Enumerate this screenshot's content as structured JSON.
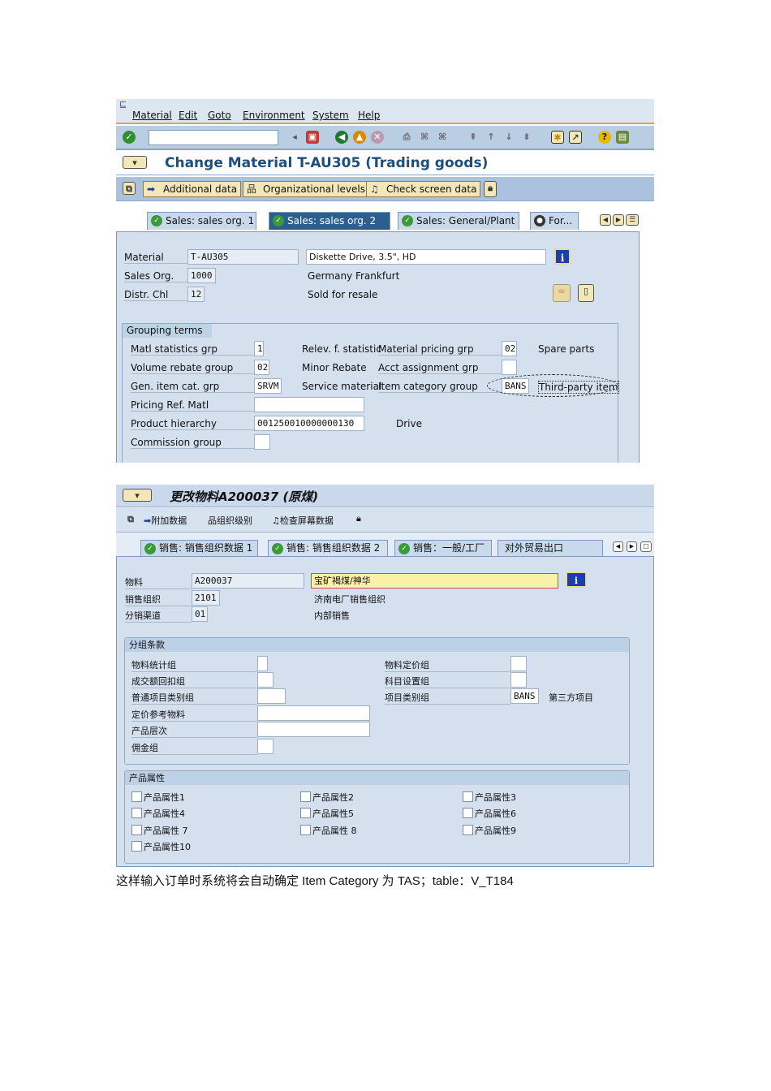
{
  "s1": {
    "menu": [
      "Material",
      "Edit",
      "Goto",
      "Environment",
      "System",
      "Help"
    ],
    "title": "Change Material T-AU305 (Trading goods)",
    "buttons": {
      "additional": "Additional data",
      "org": "Organizational levels",
      "check": "Check screen data"
    },
    "tabs": [
      "Sales: sales org. 1",
      "Sales: sales org. 2",
      "Sales: General/Plant",
      "For..."
    ],
    "header": {
      "material_label": "Material",
      "material": "T-AU305",
      "material_desc": "Diskette Drive, 3.5\", HD",
      "salesorg_label": "Sales Org.",
      "salesorg": "1000",
      "salesorg_desc": "Germany Frankfurt",
      "distr_label": "Distr. Chl",
      "distr": "12",
      "distr_desc": "Sold for resale"
    },
    "group": {
      "title": "Grouping terms",
      "matl_stat_label": "Matl statistics grp",
      "matl_stat": "1",
      "matl_stat_desc": "Relev. f. statistic",
      "vol_rebate_label": "Volume rebate group",
      "vol_rebate": "02",
      "vol_rebate_desc": "Minor Rebate",
      "gen_item_label": "Gen. item cat. grp",
      "gen_item": "SRVM",
      "gen_item_desc": "Service material",
      "pricing_ref_label": "Pricing Ref. Matl",
      "pricing_ref": "",
      "prod_hier_label": "Product hierarchy",
      "prod_hier": "001250010000000130",
      "prod_hier_desc": "Drive",
      "commission_label": "Commission group",
      "commission": "",
      "mat_pricing_label": "Material pricing grp",
      "mat_pricing": "02",
      "mat_pricing_desc": "Spare parts",
      "acct_label": "Acct assignment grp",
      "acct": "",
      "item_cat_label": "Item category group",
      "item_cat": "BANS",
      "item_cat_desc": "Third-party item"
    }
  },
  "s2": {
    "title": "更改物料A200037 (原煤)",
    "buttons": {
      "additional": "附加数据",
      "org": "组织级别",
      "check": "检查屏幕数据"
    },
    "tabs": [
      "销售: 销售组织数据 1",
      "销售: 销售组织数据 2",
      "销售：一般/工厂",
      "对外贸易出口"
    ],
    "header": {
      "material_label": "物料",
      "material": "A200037",
      "material_desc": "宝矿褐煤/神华",
      "salesorg_label": "销售组织",
      "salesorg": "2101",
      "salesorg_desc": "济南电厂销售组织",
      "distr_label": "分销渠道",
      "distr": "01",
      "distr_desc": "内部销售"
    },
    "group": {
      "title": "分组条款",
      "l": [
        "物料统计组",
        "成交额回扣组",
        "普通项目类别组",
        "定价参考物料",
        "产品层次",
        "佣金组"
      ],
      "r": [
        "物料定价组",
        "科目设置组",
        "项目类别组"
      ],
      "item_cat": "BANS",
      "item_cat_desc": "第三方项目"
    },
    "attrs": {
      "title": "产品属性",
      "items": [
        "产品属性1",
        "产品属性2",
        "产品属性3",
        "产品属性4",
        "产品属性5",
        "产品属性6",
        "产品属性 7",
        "产品属性 8",
        "产品属性9",
        "产品属性10"
      ]
    }
  },
  "footer": "这样输入订单时系统将会自动确定 Item Category 为 TAS；table：V_T184"
}
